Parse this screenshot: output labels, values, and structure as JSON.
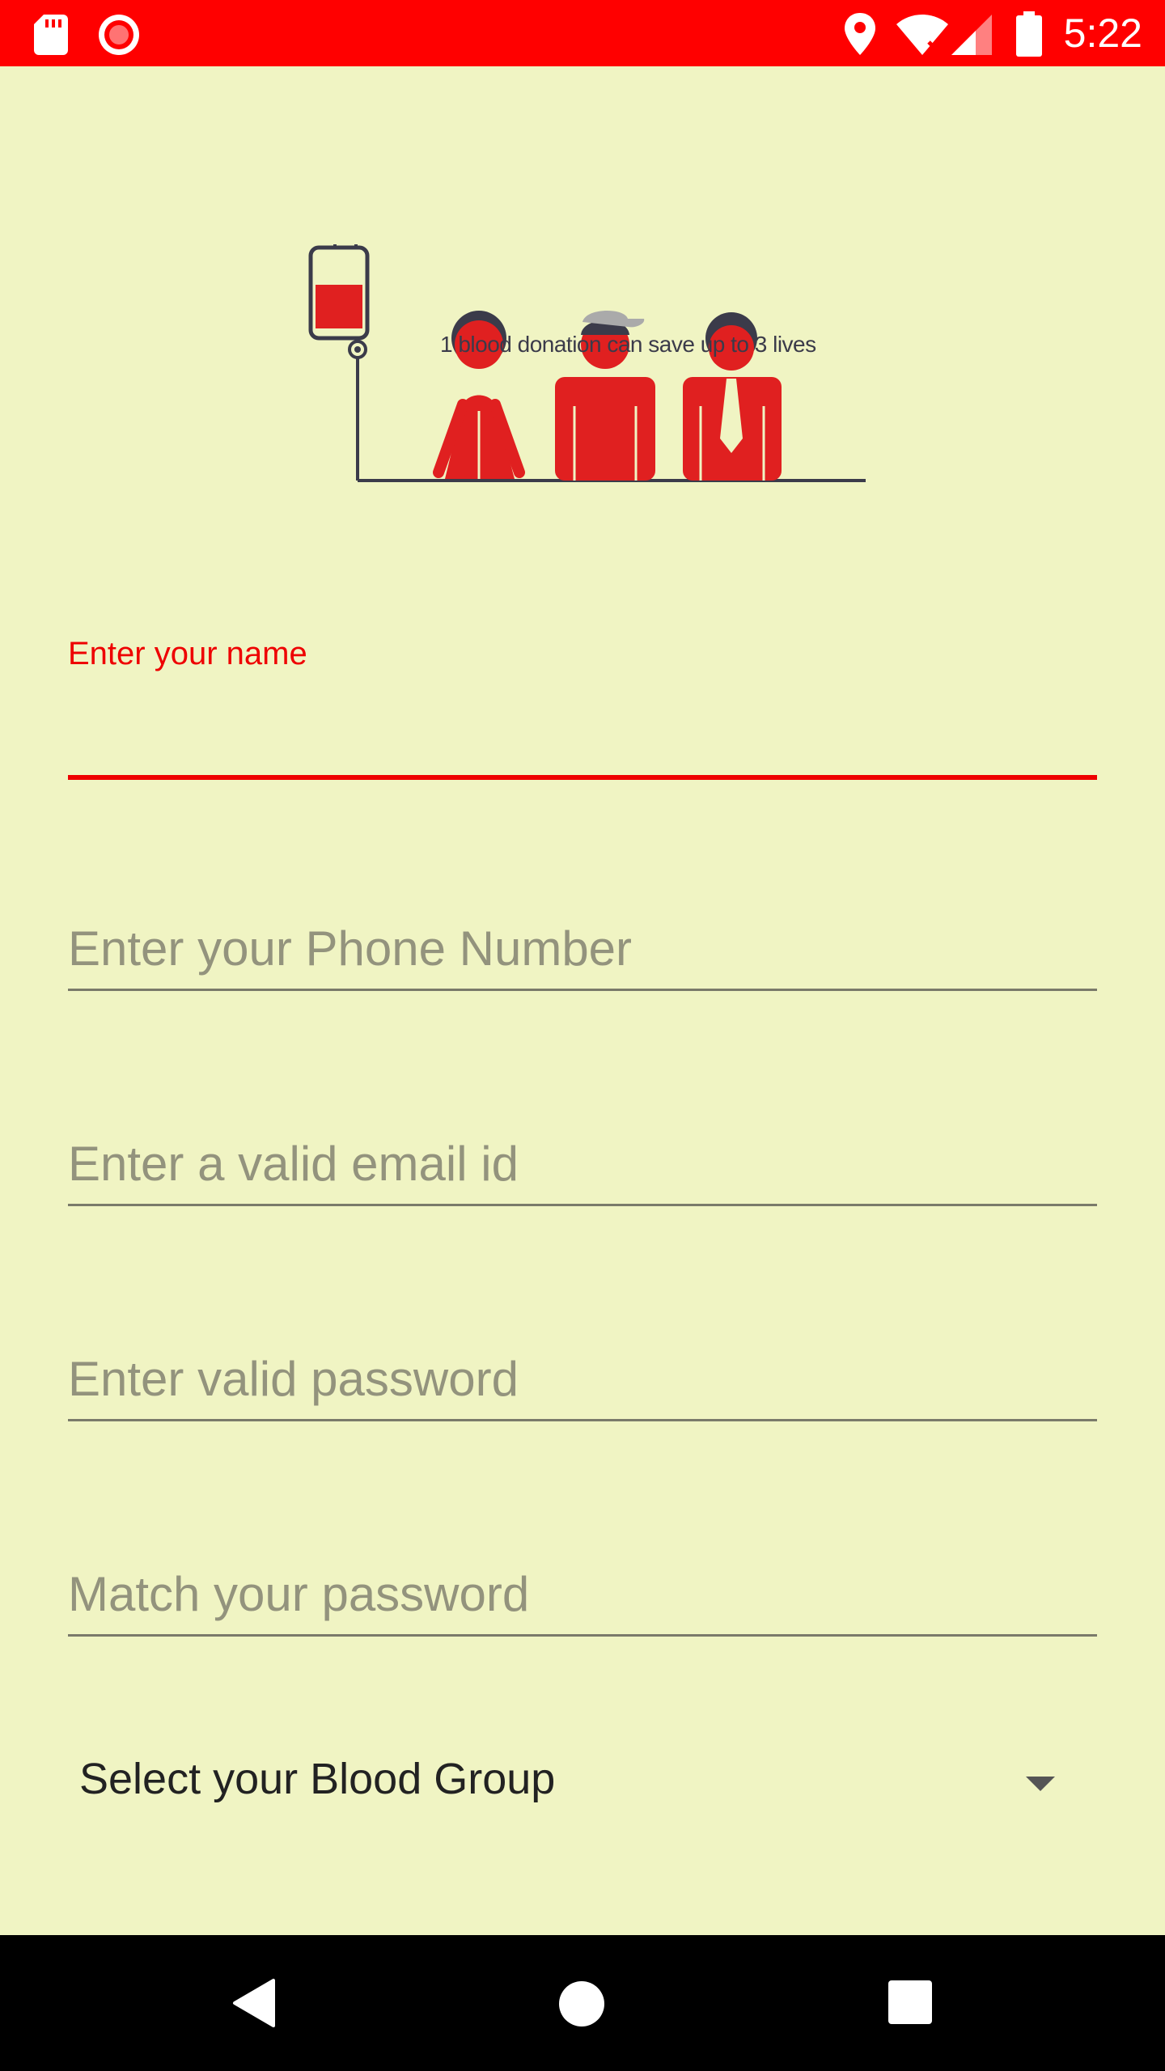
{
  "status_bar": {
    "time": "5:22",
    "background_color": "#FF0000",
    "icons_left": [
      "sd-card-icon",
      "record-icon"
    ],
    "icons_right": [
      "location-icon",
      "wifi-icon",
      "cell-signal-icon",
      "battery-icon"
    ]
  },
  "hero": {
    "caption": "1 blood donation can save up to 3 lives",
    "illustration": "blood-bag-and-three-people-illustration"
  },
  "form": {
    "name": {
      "label": "Enter your name",
      "value": "",
      "focused": true
    },
    "phone": {
      "placeholder": "Enter your Phone Number"
    },
    "email": {
      "placeholder": "Enter a valid email id"
    },
    "password": {
      "placeholder": "Enter valid password"
    },
    "confirm_password": {
      "placeholder": "Match your password"
    },
    "blood_group": {
      "selected": "Select your Blood Group"
    }
  },
  "colors": {
    "background": "#F0F4C3",
    "accent": "#EE0000",
    "figure_red": "#E02020"
  },
  "nav_bar": {
    "buttons": [
      "back-icon",
      "home-icon",
      "recents-icon"
    ]
  }
}
